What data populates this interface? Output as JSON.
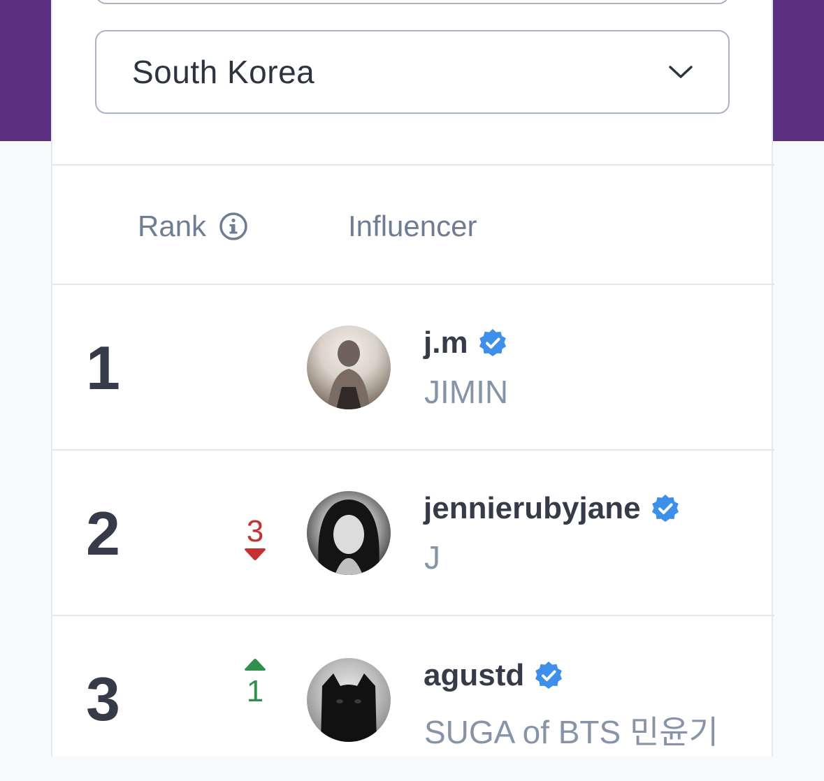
{
  "country_select": {
    "value": "South Korea",
    "icon": "chevron-down-icon"
  },
  "table": {
    "headers": {
      "rank": "Rank",
      "rank_info_icon": "info-icon",
      "influencer": "Influencer"
    },
    "rows": [
      {
        "rank": "1",
        "change": "",
        "direction": "none",
        "handle": "j.m",
        "verified": true,
        "name": "JIMIN"
      },
      {
        "rank": "2",
        "change": "3",
        "direction": "down",
        "handle": "jennierubyjane",
        "verified": true,
        "name": "J"
      },
      {
        "rank": "3",
        "change": "1",
        "direction": "up",
        "handle": "agustd",
        "verified": true,
        "name": "SUGA of BTS 민윤기"
      }
    ]
  },
  "colors": {
    "purple_band": "#5b2f82",
    "rank_down": "#c53030",
    "rank_up": "#2f8f4e",
    "verified_badge": "#3d8fea"
  }
}
